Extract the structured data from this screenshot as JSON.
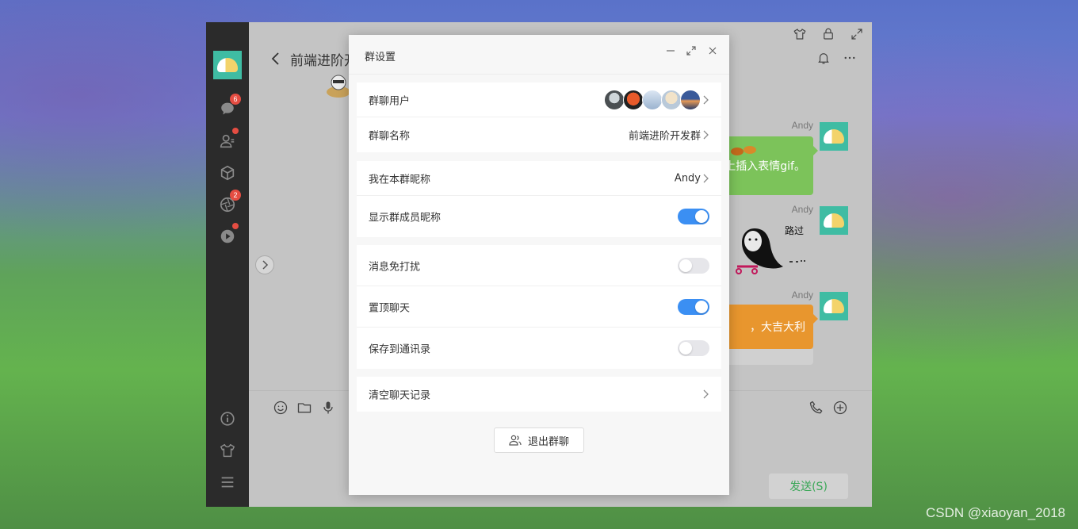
{
  "chat": {
    "title": "前端进阶开",
    "messages": [
      {
        "sender": "Andy",
        "text": "上插入表情gif。"
      },
      {
        "sender": "Andy",
        "sticker_text": "路过"
      },
      {
        "sender": "Andy",
        "text": "，大吉大利"
      }
    ],
    "send_label": "发送(S)"
  },
  "nav": {
    "chat_badge": "6",
    "discover_badge": "2"
  },
  "dialog": {
    "title": "群设置",
    "rows": {
      "members_label": "群聊用户",
      "group_name_label": "群聊名称",
      "group_name_value": "前端进阶开发群",
      "my_nickname_label": "我在本群昵称",
      "my_nickname_value": "Andy",
      "show_nicknames_label": "显示群成员昵称",
      "mute_label": "消息免打扰",
      "pin_label": "置顶聊天",
      "save_contacts_label": "保存到通讯录",
      "clear_history_label": "清空聊天记录"
    },
    "toggles": {
      "show_nicknames": true,
      "mute": false,
      "pin": true,
      "save_contacts": false
    },
    "exit_label": "退出群聊"
  },
  "watermark": "CSDN @xiaoyan_2018",
  "colors": {
    "accent": "#3b8ff3",
    "bubble_green": "#7cc35a",
    "bubble_orange": "#e8962e",
    "badge": "#e54d42",
    "sidebar": "#2b2b2b"
  }
}
